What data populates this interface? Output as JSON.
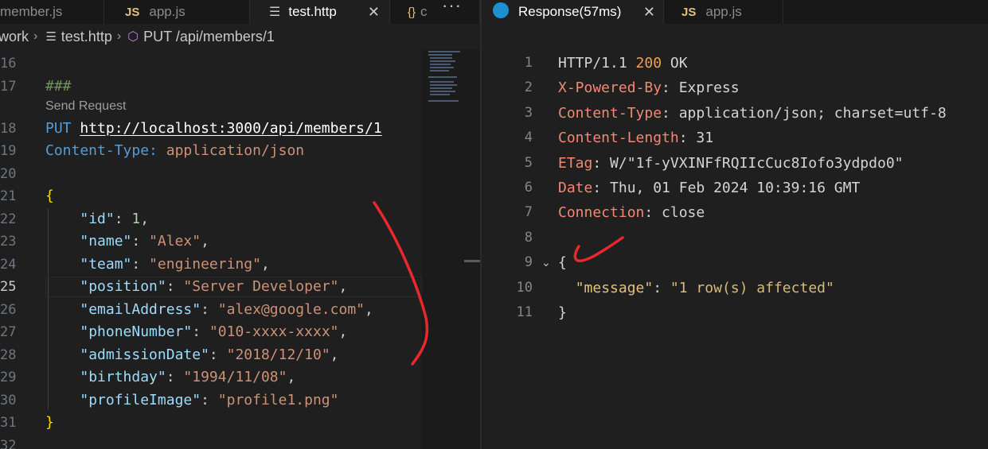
{
  "left_tabs": [
    {
      "label": "member.js",
      "icon": "JS"
    },
    {
      "label": "app.js",
      "icon": "JS"
    },
    {
      "label": "test.http",
      "icon": "http-file-icon",
      "close": "✕"
    },
    {
      "label": "c",
      "icon": "{}"
    }
  ],
  "more_actions": "···",
  "breadcrumb": {
    "folder": "work",
    "file": "test.http",
    "request": "PUT /api/members/1"
  },
  "code_lens": "Send Request",
  "editor_lines": [
    {
      "n": "16",
      "text": ""
    },
    {
      "n": "17",
      "text": "###"
    },
    {
      "n": "18",
      "method": "PUT",
      "url": "http://localhost:3000/api/members/1"
    },
    {
      "n": "19",
      "hname": "Content-Type:",
      "hval": "application/json"
    },
    {
      "n": "20",
      "text": ""
    },
    {
      "n": "21",
      "text": "{"
    },
    {
      "n": "22",
      "key": "\"id\"",
      "val": "1",
      "type": "num"
    },
    {
      "n": "23",
      "key": "\"name\"",
      "val": "\"Alex\"",
      "type": "str"
    },
    {
      "n": "24",
      "key": "\"team\"",
      "val": "\"engineering\"",
      "type": "str"
    },
    {
      "n": "25",
      "key": "\"position\"",
      "val": "\"Server Developer\"",
      "type": "str"
    },
    {
      "n": "26",
      "key": "\"emailAddress\"",
      "val": "\"alex@google.com\"",
      "type": "str"
    },
    {
      "n": "27",
      "key": "\"phoneNumber\"",
      "val": "\"010-xxxx-xxxx\"",
      "type": "str"
    },
    {
      "n": "28",
      "key": "\"admissionDate\"",
      "val": "\"2018/12/10\"",
      "type": "str"
    },
    {
      "n": "29",
      "key": "\"birthday\"",
      "val": "\"1994/11/08\"",
      "type": "str"
    },
    {
      "n": "30",
      "key": "\"profileImage\"",
      "val": "\"profile1.png\"",
      "type": "str",
      "last": true
    },
    {
      "n": "31",
      "text": "}"
    },
    {
      "n": "32",
      "text": ""
    }
  ],
  "right_tabs": [
    {
      "label": "Response(57ms)",
      "close": "✕"
    },
    {
      "label": "app.js",
      "icon": "JS"
    }
  ],
  "response_lines": [
    {
      "n": "1",
      "proto": "HTTP/1.1 ",
      "status": "200",
      "reason": " OK"
    },
    {
      "n": "2",
      "hname": "X-Powered-By",
      "hval": ": Express"
    },
    {
      "n": "3",
      "hname": "Content-Type",
      "hval": ": application/json; charset=utf-8"
    },
    {
      "n": "4",
      "hname": "Content-Length",
      "hval": ": 31"
    },
    {
      "n": "5",
      "hname": "ETag",
      "hval": ": W/\"1f-yVXINFfRQIIcCuc8Iofo3ydpdo0\""
    },
    {
      "n": "6",
      "hname": "Date",
      "hval": ": Thu, 01 Feb 2024 10:39:16 GMT"
    },
    {
      "n": "7",
      "hname": "Connection",
      "hval": ": close"
    },
    {
      "n": "8",
      "text": ""
    },
    {
      "n": "9",
      "text": "{"
    },
    {
      "n": "10",
      "key": "\"message\"",
      "val": "\"1 row(s) affected\""
    },
    {
      "n": "11",
      "text": "}"
    }
  ],
  "colors": {
    "accent_red": "#e8282b",
    "editor_bg": "#1f1f1f",
    "tab_bg": "#181818"
  }
}
